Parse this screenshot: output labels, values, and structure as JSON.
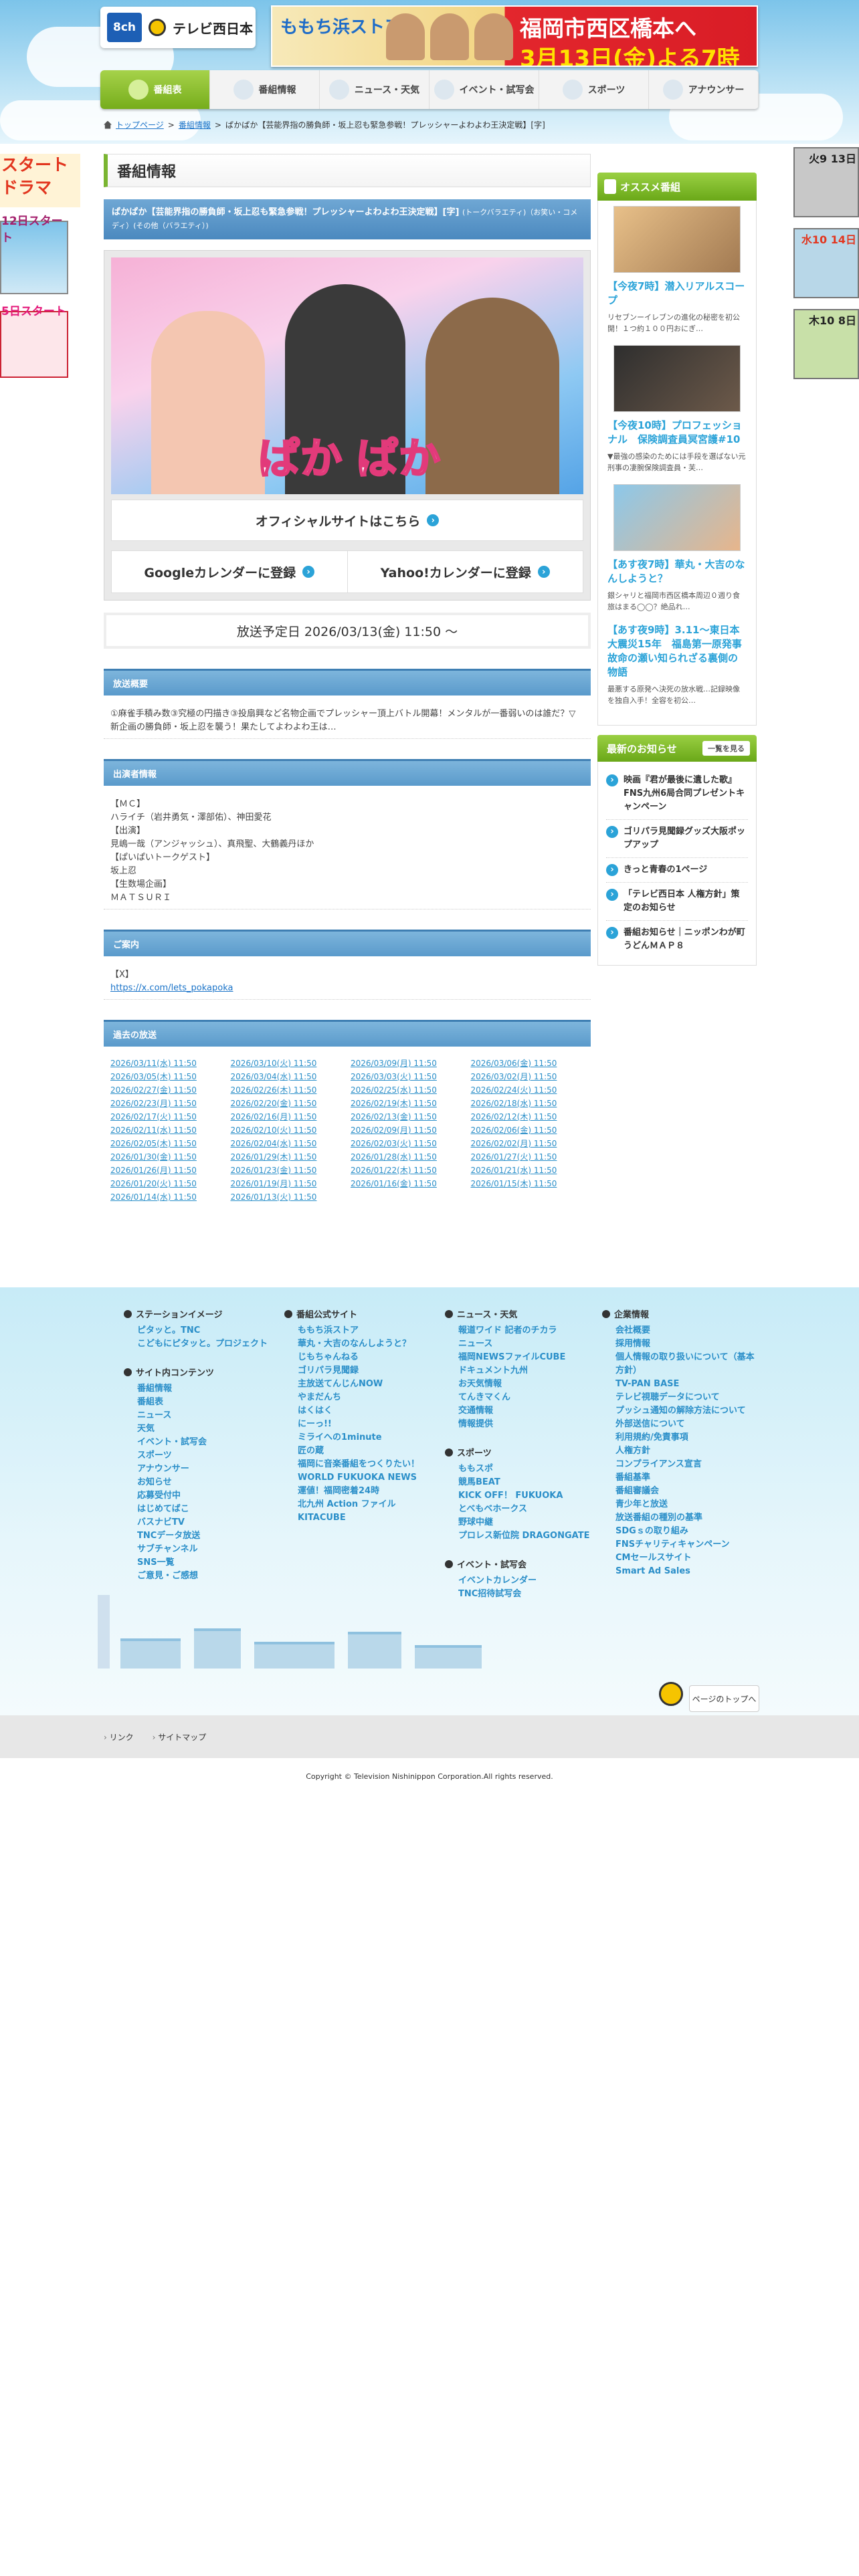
{
  "header": {
    "channel": "8ch",
    "station_name": "テレビ西日本",
    "banner": {
      "show_logo": "ももち浜ストア",
      "line1": "福岡市西区橋本へ",
      "line2": "3月13日(金)よる7時"
    },
    "nav": [
      "番組表",
      "番組情報",
      "ニュース・天気",
      "イベント・試写会",
      "スポーツ",
      "アナウンサー"
    ]
  },
  "breadcrumb": {
    "home": "トップページ",
    "section": "番組情報",
    "current": "ぱかぱか【芸能界指の勝負師・坂上忍も緊急参戦！プレッシャーよわよわ王決定戦】[字]"
  },
  "left_promo": {
    "headline": "スタート ドラマ",
    "promo1": "12日スタート",
    "promo2": "5日スタート"
  },
  "right_promo": [
    "火9 13日",
    "水10 14日",
    "木10 8日"
  ],
  "main": {
    "page_title": "番組情報",
    "program_title": "ぱかぱか【芸能界指の勝負師・坂上忍も緊急参戦！プレッシャーよわよわ王決定戦】[字]",
    "program_genres": "(トークバラエティ)（お笑い・コメディ）(その他（バラエティ）)",
    "keyart_logo": "ぱか ぱか",
    "official_site": "オフィシャルサイトはこちら",
    "google_cal": "Googleカレンダーに登録",
    "yahoo_cal": "Yahoo!カレンダーに登録",
    "airing": "放送予定日 2026/03/13(金) 11:50 〜",
    "sections": {
      "summary_h": "放送概要",
      "summary": "①麻雀手積み数③究極の円描き③投扇興など名物企画でプレッシャー頂上バトル開幕！メンタルが一番弱いのは誰だ？▽新企画の勝負師・坂上忍を襲う！果たしてよわよわ王は…",
      "cast_h": "出演者情報",
      "cast": [
        "【ＭＣ】",
        "ハライチ（岩井勇気・澤部佑）、神田愛花",
        "【出演】",
        "見嶋一哉（アンジャッシュ）、真飛聖、大鶴義丹ほか",
        "【ぱいぱいトークゲスト】",
        "坂上忍",
        "【生数場企画】",
        "ＭＡＴＳＵＲＩ"
      ],
      "info_h": "ご案内",
      "info_label": "【X】",
      "info_link": "https://x.com/lets_pokapoka",
      "past_h": "過去の放送",
      "past": [
        "2026/03/11(水) 11:50",
        "2026/03/10(火) 11:50",
        "2026/03/09(月) 11:50",
        "2026/03/06(金) 11:50",
        "2026/03/05(木) 11:50",
        "2026/03/04(水) 11:50",
        "2026/03/03(火) 11:50",
        "2026/03/02(月) 11:50",
        "2026/02/27(金) 11:50",
        "2026/02/26(木) 11:50",
        "2026/02/25(水) 11:50",
        "2026/02/24(火) 11:50",
        "2026/02/23(月) 11:50",
        "2026/02/20(金) 11:50",
        "2026/02/19(木) 11:50",
        "2026/02/18(水) 11:50",
        "2026/02/17(火) 11:50",
        "2026/02/16(月) 11:50",
        "2026/02/13(金) 11:50",
        "2026/02/12(木) 11:50",
        "2026/02/11(水) 11:50",
        "2026/02/10(火) 11:50",
        "2026/02/09(月) 11:50",
        "2026/02/06(金) 11:50",
        "2026/02/05(木) 11:50",
        "2026/02/04(水) 11:50",
        "2026/02/03(火) 11:50",
        "2026/02/02(月) 11:50",
        "2026/01/30(金) 11:50",
        "2026/01/29(木) 11:50",
        "2026/01/28(水) 11:50",
        "2026/01/27(火) 11:50",
        "2026/01/26(月) 11:50",
        "2026/01/23(金) 11:50",
        "2026/01/22(木) 11:50",
        "2026/01/21(水) 11:50",
        "2026/01/20(火) 11:50",
        "2026/01/19(月) 11:50",
        "2026/01/16(金) 11:50",
        "2026/01/15(木) 11:50",
        "2026/01/14(水) 11:50",
        "2026/01/13(火) 11:50"
      ]
    }
  },
  "sidebar": {
    "osusume_h": "オススメ番組",
    "recommended": [
      {
        "title": "【今夜7時】潜入リアルスコープ",
        "desc": "リセブンーイレブンの進化の秘密を初公開！１つ約１００円おにぎ…"
      },
      {
        "title": "【今夜10時】プロフェッショナル　保険調査員冥宮護#10",
        "desc": "▼最強の感染のためには手段を選ばない元刑事の凄腕保険調査員・芙…"
      },
      {
        "title": "【あす夜7時】華丸・大吉のなんしようと？",
        "desc": "銀シャリと福岡市西区橋本周辺０週り食旅はまる◯◯？絶品れ…"
      },
      {
        "title": "【あす夜9時】3.11〜東日本大震災15年　福島第一原発事故命の瀬い知られざる裏側の物語",
        "desc": "最悪する原発へ決死の放水戦…記録映像を独自入手！全容を初公…"
      }
    ],
    "news_h": "最新のお知らせ",
    "news_more": "一覧を見る",
    "news": [
      "映画『君が最後に遺した歌』FNS九州6局合同プレゼントキャンペーン",
      "ゴリパラ見聞録グッズ大阪ポップアップ",
      "きっと青春の1ページ",
      "「テレビ西日本 人権方針」策定のお知らせ",
      "番組お知らせ｜ニッポンわが町うどんＭＡＰ８"
    ]
  },
  "footer": {
    "cols": [
      [
        {
          "h": "ステーションイメージ",
          "links": [
            "ピタッと。TNC",
            "こどもにピタッと。プロジェクト"
          ]
        },
        {
          "h": "サイト内コンテンツ",
          "links": [
            "番組情報",
            "番組表",
            "ニュース",
            "天気",
            "イベント・試写会",
            "スポーツ",
            "アナウンサー",
            "お知らせ",
            "応募受付中",
            "はじめてばこ",
            "バスナビTV",
            "TNCデータ放送",
            "サブチャンネル",
            "SNS一覧",
            "ご意見・ご感想"
          ]
        }
      ],
      [
        {
          "h": "番組公式サイト",
          "links": [
            "ももち浜ストア",
            "華丸・大吉のなんしようと？",
            "じもちゃんねる",
            "ゴリパラ見聞録",
            "主放送てんじんNOW",
            "やまだんち",
            "はくはく",
            "にーっ!!",
            "ミライへの1minute",
            "匠の蔵",
            "福岡に音楽番組をつくりたい！",
            "WORLD FUKUOKA NEWS",
            "運値！福岡密着24時",
            "北九州 Action ファイル KITACUBE"
          ]
        }
      ],
      [
        {
          "h": "ニュース・天気",
          "links": [
            "報道ワイド 記者のチカラ",
            "ニュース",
            "福岡NEWSファイルCUBE",
            "ドキュメント九州",
            "お天気情報",
            "てんきマくん",
            "交通情報",
            "情報提供"
          ]
        },
        {
          "h": "スポーツ",
          "links": [
            "ももスポ",
            "競馬BEAT",
            "KICK OFF！ FUKUOKA",
            "とべもベホークス",
            "野球中継",
            "プロレス新位院 DRAGONGATE"
          ]
        },
        {
          "h": "イベント・試写会",
          "links": [
            "イベントカレンダー",
            "TNC招待試写会"
          ]
        }
      ],
      [
        {
          "h": "企業情報",
          "links": [
            "会社概要",
            "採用情報",
            "個人情報の取り扱いについて（基本方針）",
            "TV-PAN BASE",
            "テレビ視聴データについて",
            "プッシュ通知の解除方法について",
            "外部送信について",
            "利用規約/免責事項",
            "人権方針",
            "コンプライアンス宣言",
            "番組基準",
            "番組審議会",
            "青少年と放送",
            "放送番組の種別の基準",
            "SDGｓの取り組み",
            "FNSチャリティキャンペーン",
            "CMセールスサイト",
            "Smart Ad Sales"
          ]
        }
      ]
    ],
    "to_top": "ページのトップへ",
    "bottom_links": [
      "リンク",
      "サイトマップ"
    ],
    "copyright": "Copyright © Television Nishinippon Corporation.All rights reserved."
  }
}
